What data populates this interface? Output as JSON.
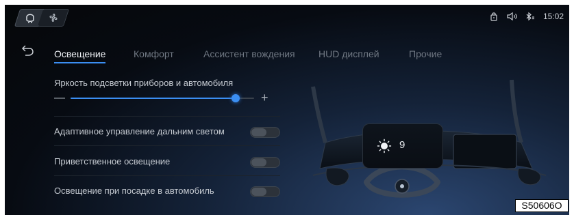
{
  "status_bar": {
    "time": "15:02",
    "icons": [
      "phone-lock-icon",
      "volume-icon",
      "bluetooth-icon"
    ]
  },
  "modes": [
    {
      "name": "headrest-icon"
    },
    {
      "name": "fan-icon"
    }
  ],
  "tabs": [
    {
      "label": "Освещение",
      "active": true
    },
    {
      "label": "Комфорт",
      "active": false
    },
    {
      "label": "Ассистент вождения",
      "active": false
    },
    {
      "label": "HUD дисплей",
      "active": false
    },
    {
      "label": "Прочие",
      "active": false
    }
  ],
  "settings": {
    "brightness": {
      "label": "Яркость подсветки приборов и автомобиля",
      "minus": "—",
      "plus": "+",
      "level": 0.9
    },
    "toggles": [
      {
        "label": "Адаптивное управление дальним светом",
        "on": false
      },
      {
        "label": "Приветственное освещение",
        "on": false
      },
      {
        "label": "Освещение при посадке в автомобиль",
        "on": false
      }
    ]
  },
  "preview": {
    "brightness_value": "9",
    "icon": "sun-icon"
  },
  "figure_code": "S50606O",
  "colors": {
    "accent": "#3b8ef2",
    "background": "#070b12",
    "text": "#c6cbd2",
    "inactive_tab": "#6f7782"
  }
}
